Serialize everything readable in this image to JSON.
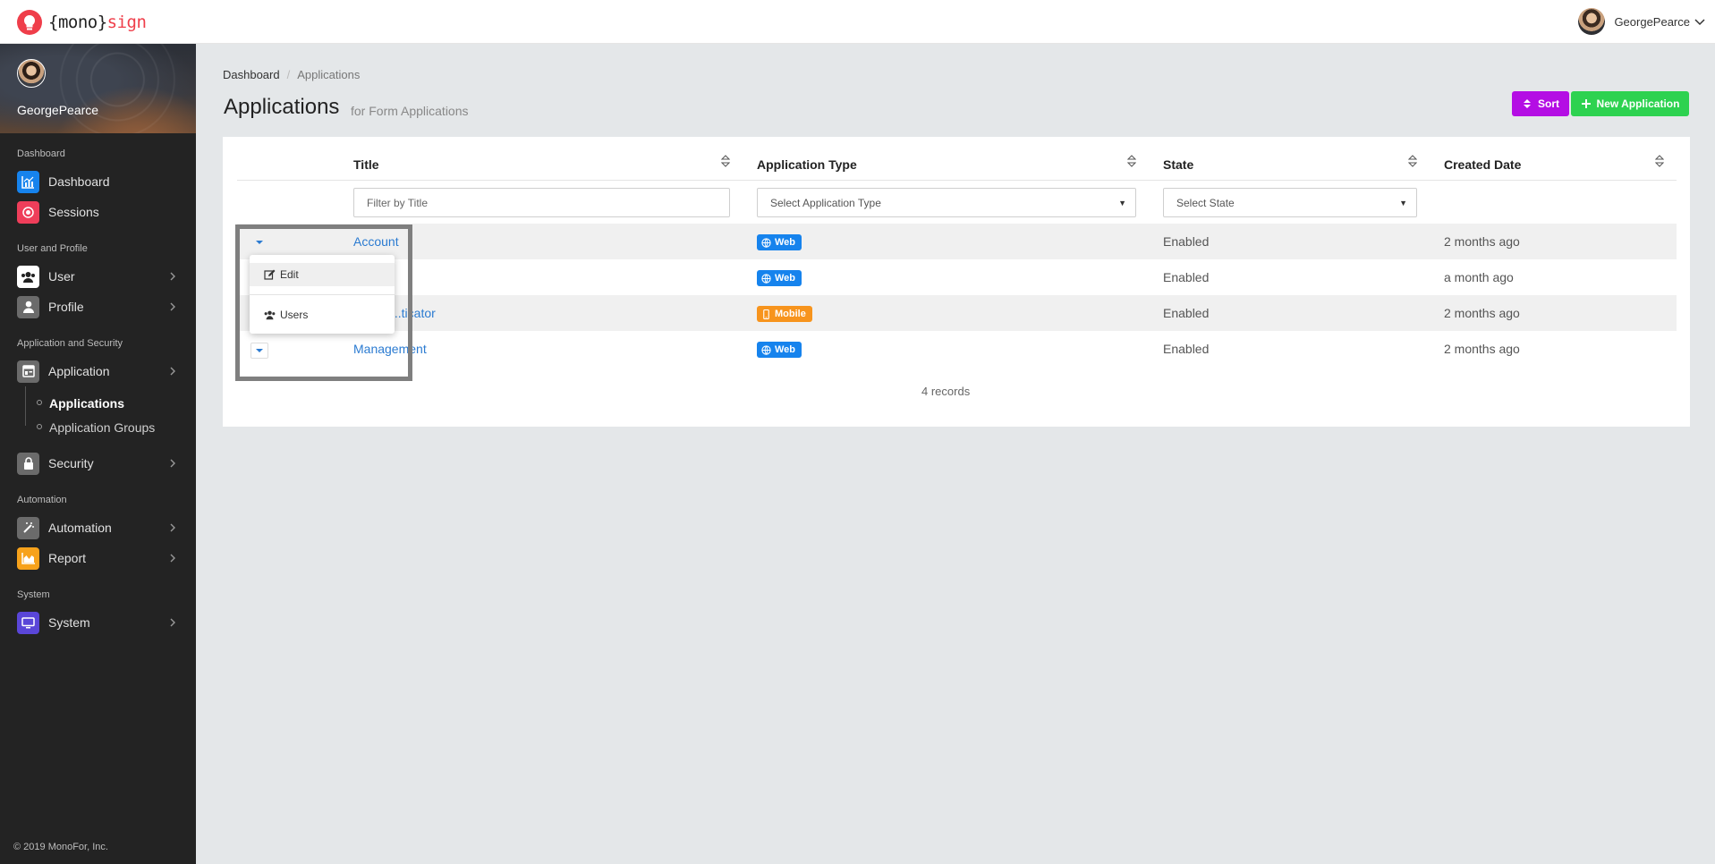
{
  "topbar": {
    "logo_prefix": "{mono}",
    "logo_suffix": "sign",
    "username": "GeorgePearce"
  },
  "sidebar": {
    "username": "GeorgePearce",
    "sections": {
      "dashboard": "Dashboard",
      "user_profile": "User and Profile",
      "app_security": "Application and Security",
      "automation": "Automation",
      "system": "System"
    },
    "items": {
      "dashboard": "Dashboard",
      "sessions": "Sessions",
      "user": "User",
      "profile": "Profile",
      "application": "Application",
      "applications": "Applications",
      "application_groups": "Application Groups",
      "security": "Security",
      "automation": "Automation",
      "report": "Report",
      "system": "System"
    },
    "colors": {
      "dashboard": "#1683ed",
      "sessions": "#ef3e5a",
      "user": "#ffffff",
      "profile": "#6b6b6b",
      "application": "#6b6b6b",
      "security": "#6b6b6b",
      "automation": "#6b6b6b",
      "report": "#f7a21b",
      "system": "#5a46d8"
    },
    "footer": "© 2019 MonoFor, Inc."
  },
  "breadcrumb": {
    "home": "Dashboard",
    "current": "Applications"
  },
  "page": {
    "title": "Applications",
    "subtitle": "for Form Applications",
    "sort_label": "Sort",
    "new_label": "New Application"
  },
  "table": {
    "columns": {
      "title": "Title",
      "type": "Application Type",
      "state": "State",
      "created": "Created Date"
    },
    "filters": {
      "title_placeholder": "Filter by Title",
      "type_placeholder": "Select Application Type",
      "state_placeholder": "Select State"
    },
    "rows": [
      {
        "title": "Account",
        "type": "Web",
        "state": "Enabled",
        "created": "2 months ago"
      },
      {
        "title": "",
        "type": "Web",
        "state": "Enabled",
        "created": "a month ago"
      },
      {
        "title": "...ticator",
        "type": "Mobile",
        "state": "Enabled",
        "created": "2 months ago"
      },
      {
        "title": "Management",
        "type": "Web",
        "state": "Enabled",
        "created": "2 months ago"
      }
    ],
    "records": "4 records"
  },
  "dropdown": {
    "edit": "Edit",
    "users": "Users"
  }
}
